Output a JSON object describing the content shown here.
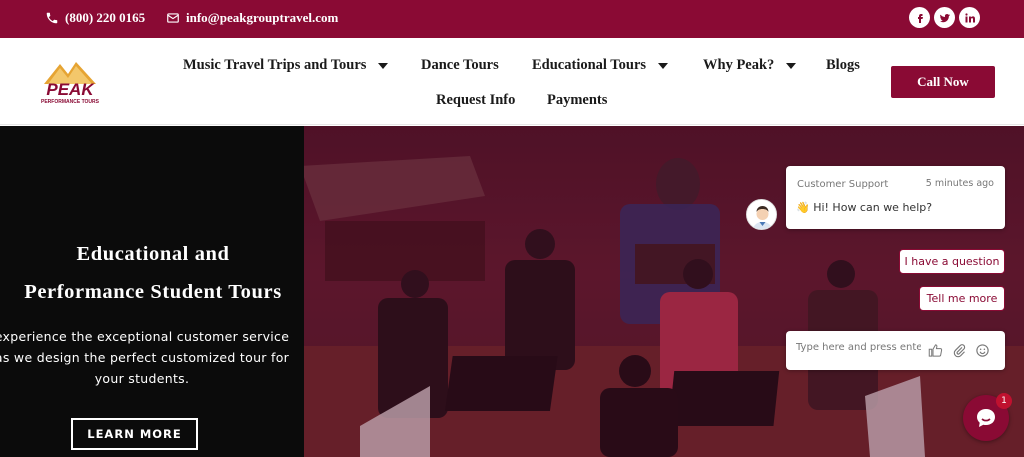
{
  "topbar": {
    "phone": "(800) 220 0165",
    "email": "info@peakgrouptravel.com",
    "phone_icon": "phone-icon",
    "email_icon": "envelope-icon",
    "social": [
      "facebook-icon",
      "twitter-icon",
      "linkedin-icon"
    ]
  },
  "logo": {
    "text": "PEAK",
    "subtext": "PERFORMANCE TOURS"
  },
  "nav": {
    "items": [
      {
        "label": "Music Travel Trips and Tours",
        "has_dropdown": true
      },
      {
        "label": "Dance Tours",
        "has_dropdown": false
      },
      {
        "label": "Educational Tours",
        "has_dropdown": true
      },
      {
        "label": "Why Peak?",
        "has_dropdown": true
      },
      {
        "label": "Blogs",
        "has_dropdown": false
      },
      {
        "label": "Request Info",
        "has_dropdown": false
      },
      {
        "label": "Payments",
        "has_dropdown": false
      }
    ],
    "cta": "Call Now"
  },
  "hero": {
    "title_line1": "Educational and",
    "title_line2": "Performance Student Tours",
    "body_line1": "experience the exceptional customer service",
    "body_line2": "as we design the perfect customized tour for",
    "body_line3": "your students.",
    "button": "LEARN MORE"
  },
  "chat": {
    "agent_name": "Customer Support",
    "time": "5 minutes ago",
    "emoji": "👋",
    "message": "Hi! How can we help?",
    "quick_replies": [
      "I have a question",
      "Tell me more"
    ],
    "input_placeholder": "Type here and press enter..",
    "unread_count": "1"
  },
  "colors": {
    "brand": "#8a0a34",
    "hero_overlay": "#4a1326"
  }
}
